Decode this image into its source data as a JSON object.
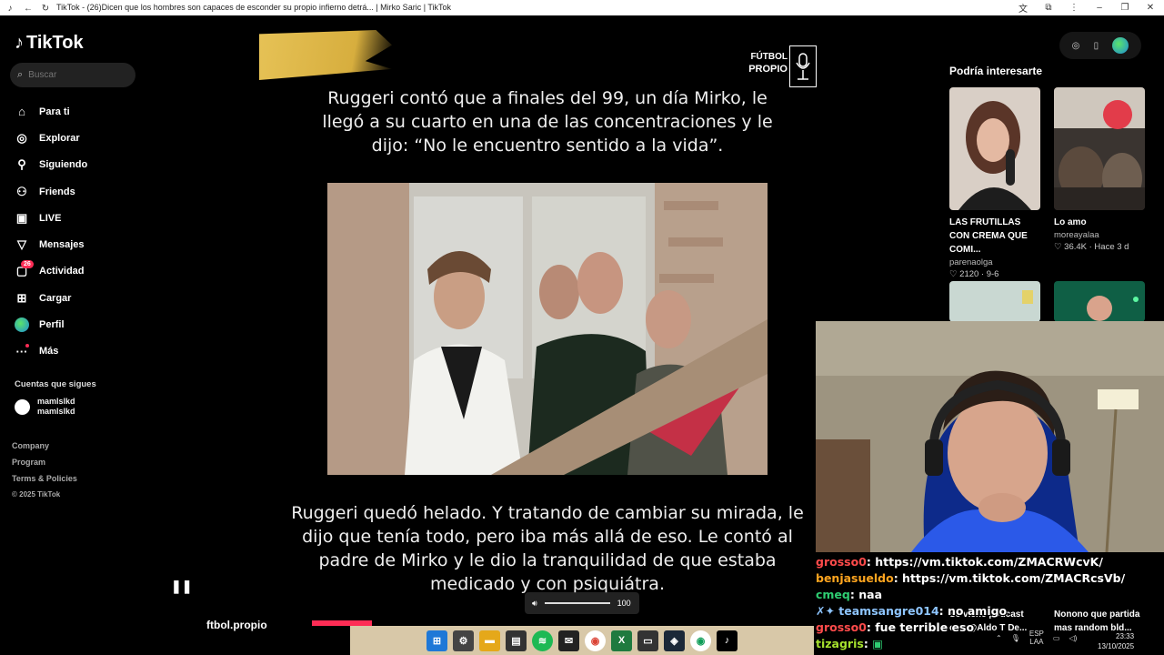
{
  "window": {
    "title": "TikTok - (26)Dicen que los hombres son capaces de esconder su propio infierno detrá... | Mirko Saric | TikTok"
  },
  "sidebar": {
    "logo": "TikTok",
    "search_placeholder": "Buscar",
    "items": [
      {
        "label": "Para ti",
        "icon": "home-icon"
      },
      {
        "label": "Explorar",
        "icon": "compass-icon"
      },
      {
        "label": "Siguiendo",
        "icon": "following-icon"
      },
      {
        "label": "Friends",
        "icon": "friends-icon"
      },
      {
        "label": "LIVE",
        "icon": "live-icon"
      },
      {
        "label": "Mensajes",
        "icon": "messages-icon"
      },
      {
        "label": "Actividad",
        "icon": "activity-icon",
        "badge": "26"
      },
      {
        "label": "Cargar",
        "icon": "upload-icon"
      },
      {
        "label": "Perfil",
        "icon": "profile-icon"
      },
      {
        "label": "Más",
        "icon": "more-icon"
      }
    ],
    "following_title": "Cuentas que sigues",
    "following": [
      {
        "name": "mamlslkd",
        "handle": "mamlslkd"
      }
    ],
    "footer": [
      "Company",
      "Program",
      "Terms & Policies"
    ],
    "copyright": "© 2025 TikTok"
  },
  "video": {
    "brand_line1": "FÚTBOL",
    "brand_line2": "PROPIO",
    "caption_top": "Ruggeri contó que a finales del 99, un día Mirko, le llegó a su cuarto en una de las concentraciones y le dijo: “No le encuentro sentido a la vida”.",
    "caption_bottom": "Ruggeri quedó helado. Y tratando de cambiar su mirada, le dijo que tenía todo, pero iba más allá de eso. Le contó al padre de Mirko y le dio la tranquilidad de que estaba medicado y con psiquiátra.",
    "volume": "100",
    "author": "ftbol.propio"
  },
  "recommendations": {
    "title": "Podría interesarte",
    "cards": [
      {
        "title": "LAS FRUTILLAS CON CREMA QUE COMI...",
        "author": "parenaolga",
        "stats": "♡ 2120 · 9-6"
      },
      {
        "title": "Lo amo",
        "author": "moreayalaa",
        "stats": "♡ 36.4K · Hace 3 d"
      },
      {
        "title": "Se viene podcast con @Aldo T De...",
        "author": "",
        "stats": ""
      },
      {
        "title": "Nonono que partida mas random bld...",
        "author": "",
        "stats": ""
      }
    ]
  },
  "chat": [
    {
      "user": "grosso0",
      "msg": "https://vm.tiktok.com/ZMACRWcvK/",
      "color": "#ff4b4b"
    },
    {
      "user": "benjasueldo",
      "msg": "https://vm.tiktok.com/ZMACRcsVb/",
      "color": "#ffa51f"
    },
    {
      "user": "cmeq",
      "msg": "naa",
      "color": "#2ecc71"
    },
    {
      "user": "✗✦ teamsangre014",
      "msg": "no amigo",
      "color": "#8ec5ff"
    },
    {
      "user": "grosso0",
      "msg": "fue terrible eso",
      "color": "#ff4b4b"
    },
    {
      "user": "tizagris",
      "msg": "▣",
      "color": "#a6e22e"
    }
  ],
  "system": {
    "lang1": "ESP",
    "lang2": "LAA",
    "time": "23:33",
    "date": "13/10/2025"
  }
}
